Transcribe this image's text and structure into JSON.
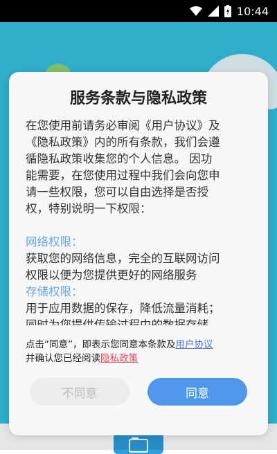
{
  "status_bar": {
    "time": "10:44"
  },
  "dialog": {
    "title": "服务条款与隐私政策",
    "body": {
      "intro_lines": [
        "在您使用前请务必审阅《用户协议》及",
        "《隐私政策》内的所有条款，我们会遵",
        "循隐私政策收集您的个人信息。 因功",
        "能需要，在您使用过程中我们会向您申",
        "请一些权限，您可以自由选择是否授",
        "权，特别说明一下权限："
      ],
      "permissions": [
        {
          "title": "网络权限：",
          "lines": [
            "获取您的网络信息，完全的互联网访问",
            "权限以便为您提供更好的网络服务"
          ]
        },
        {
          "title": "存储权限：",
          "lines": [
            "用于应用数据的保存，降低流量消耗；",
            "同时为您提供传输过程中的数据存储"
          ]
        }
      ]
    },
    "footer": {
      "line1_prefix": "点击“同意”，即表示您同意本条款及",
      "user_agreement_link": "用户协议",
      "line2_prefix": "并确认您已经阅读",
      "privacy_link": "隐私政策"
    },
    "buttons": {
      "disagree": "不同意",
      "agree": "同意"
    }
  },
  "colors": {
    "app_background": "#35c2e4",
    "permission_title": "#67a8e9",
    "agree_button": "#4e97ea",
    "privacy_link": "#f04a58",
    "user_link": "#4c79e0"
  }
}
